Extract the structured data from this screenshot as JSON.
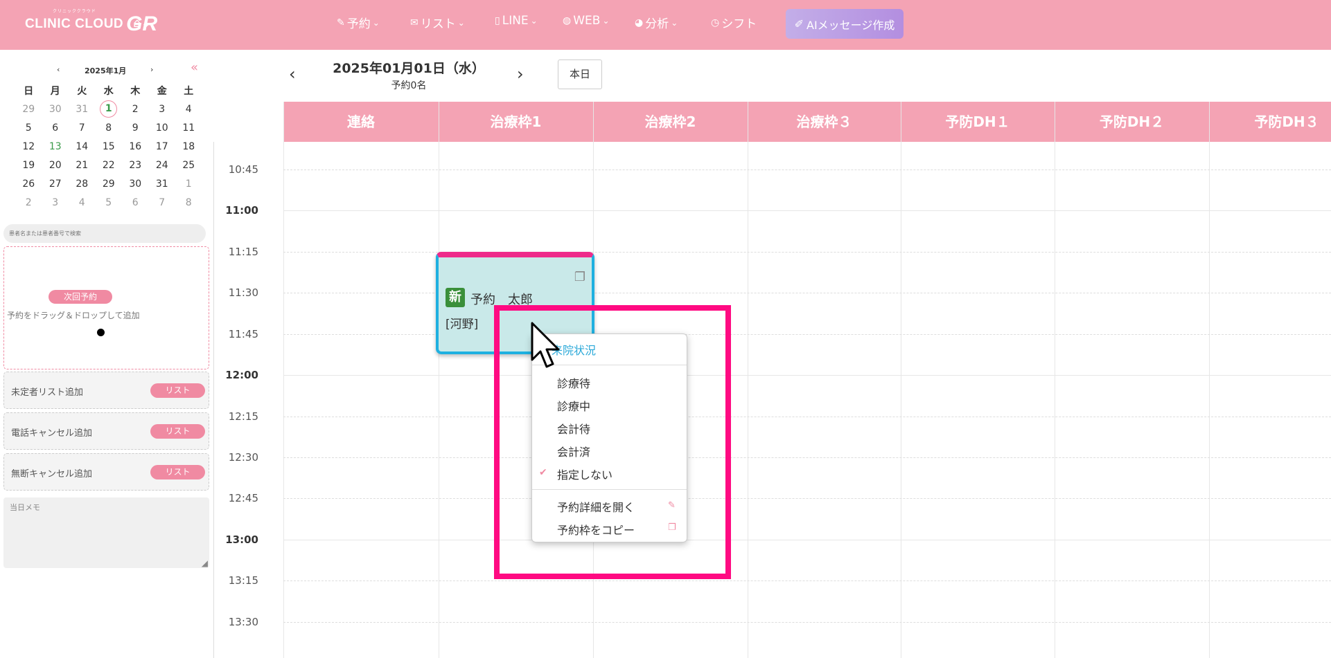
{
  "app": {
    "logo_text": "CLINIC CLOUD",
    "logo_gr": "GR",
    "logo_sub": "クリニッククラウド"
  },
  "nav": {
    "home_icon": "home-icon",
    "items": [
      {
        "label": "予約",
        "icon": "edit-icon"
      },
      {
        "label": "リスト",
        "icon": "mail-icon"
      },
      {
        "label": "LINE",
        "icon": "phone-icon"
      },
      {
        "label": "WEB",
        "icon": "globe-icon"
      },
      {
        "label": "分析",
        "icon": "pie-icon"
      },
      {
        "label": "シフト",
        "icon": "clock-icon"
      }
    ],
    "ai_button": "AIメッセージ作成"
  },
  "mini_calendar": {
    "month_label": "2025年1月",
    "weekdays": [
      "日",
      "月",
      "火",
      "水",
      "木",
      "金",
      "土"
    ],
    "weeks": [
      [
        "29",
        "30",
        "31",
        "1",
        "2",
        "3",
        "4"
      ],
      [
        "5",
        "6",
        "7",
        "8",
        "9",
        "10",
        "11"
      ],
      [
        "12",
        "13",
        "14",
        "15",
        "16",
        "17",
        "18"
      ],
      [
        "19",
        "20",
        "21",
        "22",
        "23",
        "24",
        "25"
      ],
      [
        "26",
        "27",
        "28",
        "29",
        "30",
        "31",
        "1"
      ],
      [
        "2",
        "3",
        "4",
        "5",
        "6",
        "7",
        "8"
      ]
    ],
    "selected_day": "1",
    "today": "13"
  },
  "sidebar": {
    "search_placeholder": "患者名または患者番号で検索",
    "next_badge": "次回予約",
    "drop_hint": "予約をドラッグ＆ドロップして追加",
    "lists": [
      {
        "label": "未定者リスト追加",
        "button": "リスト"
      },
      {
        "label": "電話キャンセル追加",
        "button": "リスト"
      },
      {
        "label": "無断キャンセル追加",
        "button": "リスト"
      }
    ],
    "memo_label": "当日メモ"
  },
  "date_header": {
    "title": "2025年01月01日（水）",
    "subtitle": "予約0名",
    "today_button": "本日"
  },
  "columns": [
    "連絡",
    "治療枠1",
    "治療枠2",
    "治療枠３",
    "予防DH１",
    "予防DH２",
    "予防DH３"
  ],
  "times": [
    "10:45",
    "11:00",
    "11:15",
    "11:30",
    "11:45",
    "12:00",
    "12:15",
    "12:30",
    "12:45",
    "13:00",
    "13:15",
    "13:30"
  ],
  "appointment": {
    "badge": "新",
    "patient": "予約　太郎",
    "staff": "[河野]",
    "column": "治療枠1",
    "accent_top": "#ee2a8a",
    "border_color": "#1fb0e0"
  },
  "context_menu": {
    "header": "来院状況",
    "statuses": [
      "診療待",
      "診療中",
      "会計待",
      "会計済",
      "指定しない"
    ],
    "checked": "指定しない",
    "actions": [
      "予約詳細を開く",
      "予約枠をコピー"
    ]
  },
  "colors": {
    "brand_pink": "#f4a3b4",
    "accent_pink": "#f08aa2",
    "highlight": "#ff0a82"
  }
}
